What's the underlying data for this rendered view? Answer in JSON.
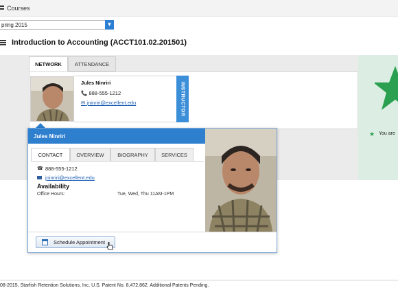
{
  "header": {
    "courses_label": "Courses",
    "courses_icon": "list-icon"
  },
  "term": {
    "selected": "pring 2015"
  },
  "course": {
    "title": "Introduction to Accounting (ACCT101.02.201501)"
  },
  "tabs": [
    {
      "label": "NETWORK",
      "active": true
    },
    {
      "label": "ATTENDANCE",
      "active": false
    }
  ],
  "card": {
    "name": "Jules Ninriri",
    "phone": "888-555-1212",
    "email": "jninriri@excellent.edu",
    "role_tab": "INSTRUCTOR"
  },
  "popover": {
    "name": "Jules Ninriri",
    "tabs": [
      "CONTACT",
      "OVERVIEW",
      "BIOGRAPHY",
      "SERVICES"
    ],
    "active_tab": "CONTACT",
    "phone": "888-555-1212",
    "email": "jninriri@excellent.edu",
    "availability_heading": "Availability",
    "office_hours_label": "Office Hours:",
    "office_hours_value": "Tue, Wed, Thu 11AM-1PM",
    "schedule_button": "Schedule Appointment"
  },
  "side_panel": {
    "text": "You are"
  },
  "footer": {
    "text": "08-2015, Starfish Retention Solutions, Inc. U.S. Patent No. 8,472,862. Additional Patents Pending."
  },
  "colors": {
    "accent": "#2f7fcf",
    "star": "#2aa050",
    "side_panel": "#dceee3"
  }
}
